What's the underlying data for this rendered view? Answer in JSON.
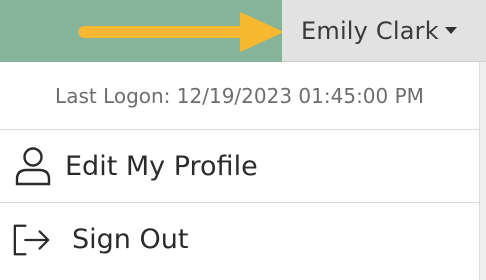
{
  "header": {
    "user_name": "Emily Clark",
    "bar_color": "#86b49a"
  },
  "annotation": {
    "arrow_color": "#f6b830",
    "icon": "arrow-right-icon"
  },
  "dropdown": {
    "last_logon": "Last Logon: 12/19/2023 01:45:00 PM",
    "items": [
      {
        "label": "Edit My Profile",
        "icon": "user-icon"
      },
      {
        "label": "Sign Out",
        "icon": "sign-out-icon"
      }
    ]
  }
}
